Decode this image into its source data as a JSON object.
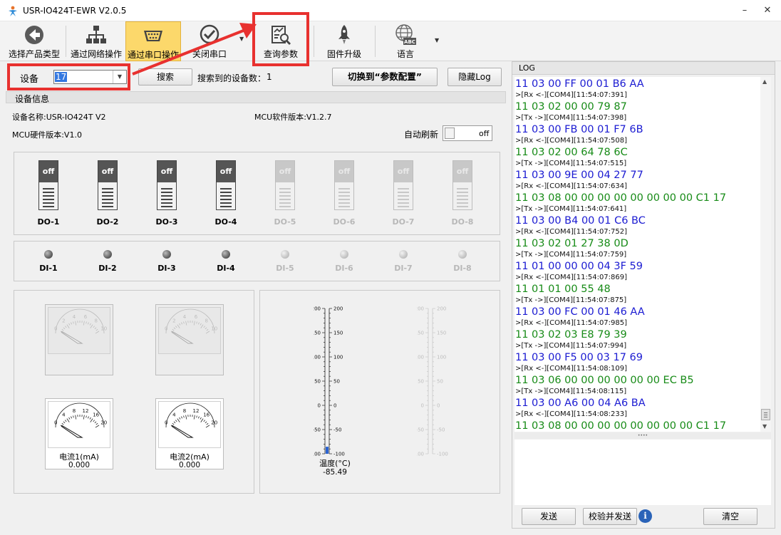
{
  "window": {
    "title": "USR-IO424T-EWR V2.0.5",
    "minimize": "–",
    "close": "✕"
  },
  "toolbar": {
    "items": [
      {
        "label": "选择产品类型",
        "icon": "back-arrow-icon"
      },
      {
        "label": "通过网络操作",
        "icon": "network-icon"
      },
      {
        "label": "通过串口操作",
        "icon": "serial-port-icon"
      },
      {
        "label": "关闭串口",
        "icon": "check-circle-icon"
      },
      {
        "label": "查询参数",
        "icon": "query-search-icon"
      },
      {
        "label": "固件升级",
        "icon": "rocket-icon"
      },
      {
        "label": "语言",
        "icon": "globe-abc-icon"
      }
    ],
    "language_abc": "ABC"
  },
  "device_row": {
    "device_label": "设备",
    "device_value": "17",
    "search_button": "搜索",
    "found_label": "搜索到的设备数：",
    "found_count": "1",
    "switch_button": "切换到“参数配置”",
    "hide_log_button": "隐藏Log"
  },
  "device_info": {
    "section_title": "设备信息",
    "name_label": "设备名称:USR-IO424T V2",
    "mcu_sw_label": "MCU软件版本:V1.2.7",
    "mcu_hw_label": "MCU硬件版本:V1.0",
    "auto_refresh_label": "自动刷新",
    "auto_refresh_state": "off"
  },
  "do_switches": [
    {
      "label": "DO-1",
      "state": "off",
      "enabled": true
    },
    {
      "label": "DO-2",
      "state": "off",
      "enabled": true
    },
    {
      "label": "DO-3",
      "state": "off",
      "enabled": true
    },
    {
      "label": "DO-4",
      "state": "off",
      "enabled": true
    },
    {
      "label": "DO-5",
      "state": "off",
      "enabled": false
    },
    {
      "label": "DO-6",
      "state": "off",
      "enabled": false
    },
    {
      "label": "DO-7",
      "state": "off",
      "enabled": false
    },
    {
      "label": "DO-8",
      "state": "off",
      "enabled": false
    }
  ],
  "di_inputs": [
    {
      "label": "DI-1",
      "enabled": true
    },
    {
      "label": "DI-2",
      "enabled": true
    },
    {
      "label": "DI-3",
      "enabled": true
    },
    {
      "label": "DI-4",
      "enabled": true
    },
    {
      "label": "DI-5",
      "enabled": false
    },
    {
      "label": "DI-6",
      "enabled": false
    },
    {
      "label": "DI-7",
      "enabled": false
    },
    {
      "label": "DI-8",
      "enabled": false
    }
  ],
  "gauges": [
    {
      "enabled": false,
      "ticks": [
        "0",
        "2",
        "4",
        "6",
        "8",
        "10"
      ],
      "label": "",
      "value": ""
    },
    {
      "enabled": false,
      "ticks": [
        "0",
        "2",
        "4",
        "6",
        "8",
        "10"
      ],
      "label": "",
      "value": ""
    },
    {
      "enabled": true,
      "ticks": [
        "0",
        "4",
        "8",
        "12",
        "16",
        "20"
      ],
      "label": "电流1(mA)",
      "value": "0.000"
    },
    {
      "enabled": true,
      "ticks": [
        "0",
        "4",
        "8",
        "12",
        "16",
        "20"
      ],
      "label": "电流2(mA)",
      "value": "0.000"
    }
  ],
  "thermometers": [
    {
      "enabled": true,
      "scale": [
        "200",
        "150",
        "100",
        "50",
        "0",
        "-50",
        "-100"
      ],
      "label": "温度(°C)",
      "value": "-85.49"
    },
    {
      "enabled": false,
      "scale": [
        "200",
        "150",
        "100",
        "50",
        "0",
        "-50",
        "-100"
      ],
      "label": "",
      "value": ""
    }
  ],
  "log": {
    "title": "LOG",
    "lines": [
      {
        "kind": "tx",
        "text": "11 03 00 FF 00 01 B6 AA"
      },
      {
        "kind": "meta",
        "text": ">[Rx <-][COM4][11:54:07:391]"
      },
      {
        "kind": "rx",
        "text": "11 03 02 00 00 79 87"
      },
      {
        "kind": "meta",
        "text": ">[Tx ->][COM4][11:54:07:398]"
      },
      {
        "kind": "tx",
        "text": "11 03 00 FB 00 01 F7 6B"
      },
      {
        "kind": "meta",
        "text": ">[Rx <-][COM4][11:54:07:508]"
      },
      {
        "kind": "rx",
        "text": "11 03 02 00 64 78 6C"
      },
      {
        "kind": "meta",
        "text": ">[Tx ->][COM4][11:54:07:515]"
      },
      {
        "kind": "tx",
        "text": "11 03 00 9E 00 04 27 77"
      },
      {
        "kind": "meta",
        "text": ">[Rx <-][COM4][11:54:07:634]"
      },
      {
        "kind": "rx",
        "text": "11 03 08 00 00 00 00 00 00 00 00 C1 17"
      },
      {
        "kind": "meta",
        "text": ">[Tx ->][COM4][11:54:07:641]"
      },
      {
        "kind": "tx",
        "text": "11 03 00 B4 00 01 C6 BC"
      },
      {
        "kind": "meta",
        "text": ">[Rx <-][COM4][11:54:07:752]"
      },
      {
        "kind": "rx",
        "text": "11 03 02 01 27 38 0D"
      },
      {
        "kind": "meta",
        "text": ">[Tx ->][COM4][11:54:07:759]"
      },
      {
        "kind": "tx",
        "text": "11 01 00 00 00 04 3F 59"
      },
      {
        "kind": "meta",
        "text": ">[Rx <-][COM4][11:54:07:869]"
      },
      {
        "kind": "rx",
        "text": "11 01 01 00 55 48"
      },
      {
        "kind": "meta",
        "text": ">[Tx ->][COM4][11:54:07:875]"
      },
      {
        "kind": "tx",
        "text": "11 03 00 FC 00 01 46 AA"
      },
      {
        "kind": "meta",
        "text": ">[Rx <-][COM4][11:54:07:985]"
      },
      {
        "kind": "rx",
        "text": "11 03 02 03 E8 79 39"
      },
      {
        "kind": "meta",
        "text": ">[Tx ->][COM4][11:54:07:994]"
      },
      {
        "kind": "tx",
        "text": "11 03 00 F5 00 03 17 69"
      },
      {
        "kind": "meta",
        "text": ">[Rx <-][COM4][11:54:08:109]"
      },
      {
        "kind": "rx",
        "text": "11 03 06 00 00 00 00 00 00 EC B5"
      },
      {
        "kind": "meta",
        "text": ">[Tx ->][COM4][11:54:08:115]"
      },
      {
        "kind": "tx",
        "text": "11 03 00 A6 00 04 A6 BA"
      },
      {
        "kind": "meta",
        "text": ">[Rx <-][COM4][11:54:08:233]"
      },
      {
        "kind": "rx",
        "text": "11 03 08 00 00 00 00 00 00 00 00 C1 17"
      }
    ],
    "splitter": "••••",
    "send_button": "发送",
    "verify_send_button": "校验并发送",
    "info_icon": "i",
    "clear_button": "清空"
  },
  "colors": {
    "tx": "#1b1bd2",
    "rx": "#178b17",
    "annotation": "#e8312f",
    "active_tab": "#fcd86b"
  }
}
